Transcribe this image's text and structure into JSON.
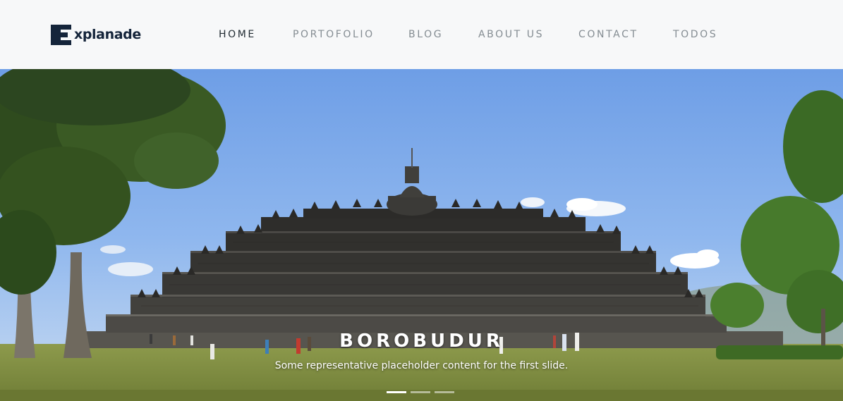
{
  "brand": {
    "mark_letter": "E",
    "name": "xplanade"
  },
  "nav": {
    "items": [
      {
        "label": "HOME",
        "active": true
      },
      {
        "label": "PORTOFOLIO",
        "active": false
      },
      {
        "label": "BLOG",
        "active": false
      },
      {
        "label": "ABOUT US",
        "active": false
      },
      {
        "label": "CONTACT",
        "active": false
      },
      {
        "label": "TODOS",
        "active": false
      }
    ]
  },
  "carousel": {
    "slide": {
      "title": "BOROBUDUR",
      "text": "Some representative placeholder content for the first slide."
    },
    "slide_count": 3,
    "active_index": 0
  },
  "colors": {
    "navbar_bg": "#f7f8f9",
    "brand": "#14243a",
    "nav_active": "#212b33",
    "nav_inactive": "#848c92"
  }
}
